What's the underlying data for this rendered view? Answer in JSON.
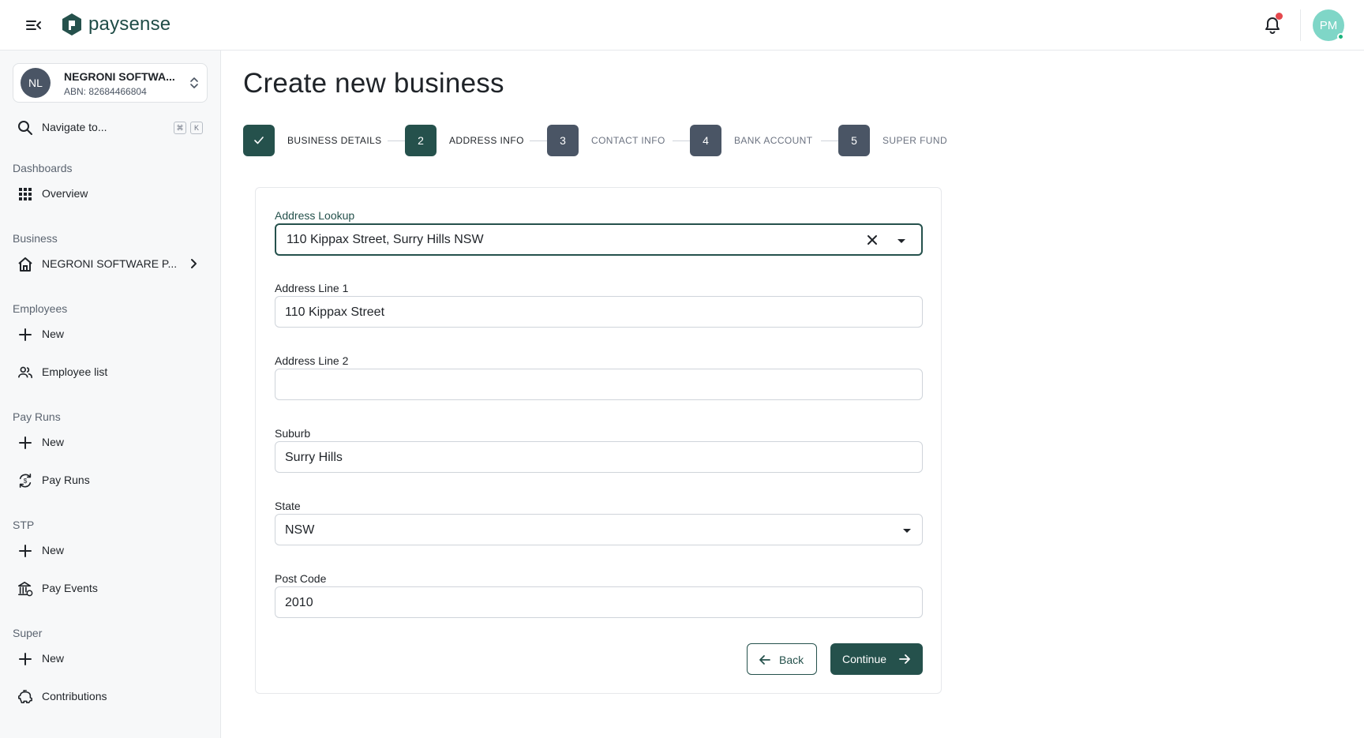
{
  "header": {
    "brand": "paysense",
    "avatar_initials": "PM",
    "colors": {
      "brand": "#25514c",
      "avatar": "#7fd6c7",
      "notification_dot": "#e5484d"
    }
  },
  "sidebar": {
    "org": {
      "initials": "NL",
      "name": "NEGRONI SOFTWA...",
      "abn": "ABN: 82684466804"
    },
    "search": {
      "label": "Navigate to...",
      "shortcut_keys": [
        "⌘",
        "K"
      ]
    },
    "sections": [
      {
        "title": "Dashboards",
        "items": [
          {
            "label": "Overview",
            "icon": "grid-icon"
          }
        ]
      },
      {
        "title": "Business",
        "items": [
          {
            "label": "NEGRONI SOFTWARE P...",
            "icon": "home-icon"
          }
        ]
      },
      {
        "title": "Employees",
        "items": [
          {
            "label": "New",
            "icon": "plus-icon"
          },
          {
            "label": "Employee list",
            "icon": "people-icon"
          }
        ]
      },
      {
        "title": "Pay Runs",
        "items": [
          {
            "label": "New",
            "icon": "plus-icon"
          },
          {
            "label": "Pay Runs",
            "icon": "cycle-icon"
          }
        ]
      },
      {
        "title": "STP",
        "items": [
          {
            "label": "New",
            "icon": "plus-icon"
          },
          {
            "label": "Pay Events",
            "icon": "bank-icon"
          }
        ]
      },
      {
        "title": "Super",
        "items": [
          {
            "label": "New",
            "icon": "plus-icon"
          },
          {
            "label": "Contributions",
            "icon": "piggy-bank-icon"
          }
        ]
      }
    ]
  },
  "main": {
    "title": "Create new business",
    "steps": [
      {
        "number": "✓",
        "label": "BUSINESS DETAILS",
        "state": "done"
      },
      {
        "number": "2",
        "label": "ADDRESS INFO",
        "state": "active"
      },
      {
        "number": "3",
        "label": "CONTACT INFO",
        "state": "todo"
      },
      {
        "number": "4",
        "label": "BANK ACCOUNT",
        "state": "todo"
      },
      {
        "number": "5",
        "label": "SUPER FUND",
        "state": "todo"
      }
    ],
    "form": {
      "lookup": {
        "label": "Address Lookup",
        "value": "110 Kippax Street, Surry Hills NSW"
      },
      "address1": {
        "label": "Address Line 1",
        "value": "110 Kippax Street"
      },
      "address2": {
        "label": "Address Line 2",
        "value": ""
      },
      "suburb": {
        "label": "Suburb",
        "value": "Surry Hills"
      },
      "state": {
        "label": "State",
        "value": "NSW"
      },
      "postcode": {
        "label": "Post Code",
        "value": "2010"
      }
    },
    "buttons": {
      "back": "Back",
      "continue": "Continue"
    }
  }
}
